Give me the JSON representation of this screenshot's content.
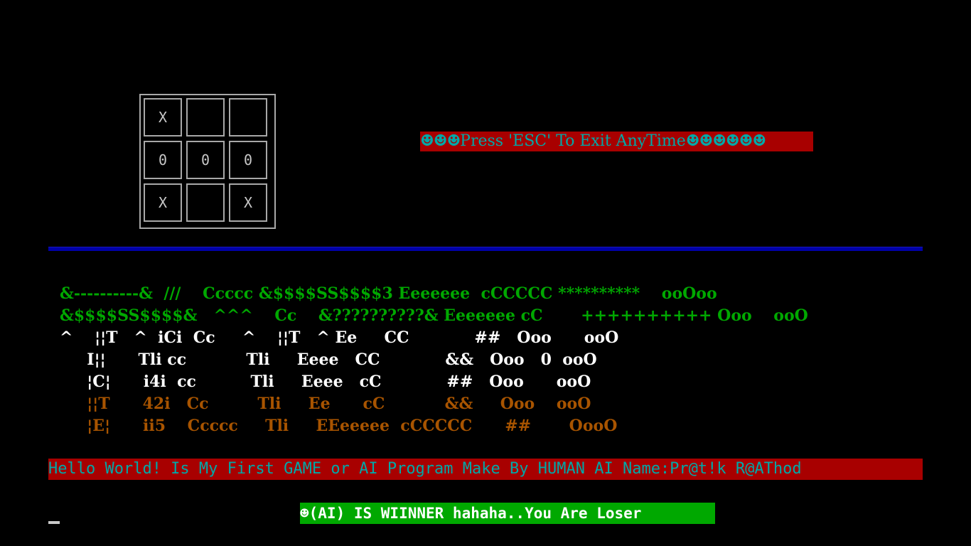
{
  "board": {
    "cells": [
      "X",
      "",
      "",
      "0",
      "0",
      "0",
      "X",
      "",
      "X"
    ]
  },
  "banners": {
    "esc_smileys_left": "☻☻☻",
    "esc_text": "Press 'ESC' To Exit AnyTime",
    "esc_smileys_right": "☻☻☻☻☻☻",
    "hello": "Hello World! Is My First GAME or AI Program Make By HUMAN AI Name:Pr@t!k R@AThod",
    "winner": "☻(AI) IS WIINNER hahaha..You Are Loser"
  },
  "ascii_art": {
    "lines": [
      {
        "color": "g",
        "text": "&----------&  ///    Ccccc &$$$$SS$$$$3 Eeeeeee  cCCCCC **********    ooOoo"
      },
      {
        "color": "g",
        "text": "&$$$$SS$$$$&   ^^^    Cc    &??????????& Eeeeeee cC       ++++++++++ Ooo    ooO"
      },
      {
        "color": "w",
        "text": "^    ¦¦T   ^  iCi  Cc     ^    ¦¦T   ^ Ee     CC            ##   Ooo      ooO"
      },
      {
        "color": "w",
        "text": "     I¦¦      Tli cc           Tli     Eeee   CC            &&   Ooo   0  ooO"
      },
      {
        "color": "w",
        "text": "     ¦C¦      i4i  cc          Tli     Eeee   cC            ##   Ooo      ooO"
      },
      {
        "color": "o",
        "text": "     ¦¦T      42i   Cc         Tli     Ee      cC           &&     Ooo    ooO"
      },
      {
        "color": "o",
        "text": "     ¦E¦      ii5    Ccccc     Tli     EEeeeee  cCCCCC      ##       OooO"
      }
    ]
  },
  "colors": {
    "banner_red": "#a80000",
    "text_cyan": "#00a8a8",
    "winner_green": "#00a800",
    "divider_blue": "#0000a8",
    "art_green": "#00a800",
    "art_white": "#ffffff",
    "art_orange": "#a85400"
  }
}
